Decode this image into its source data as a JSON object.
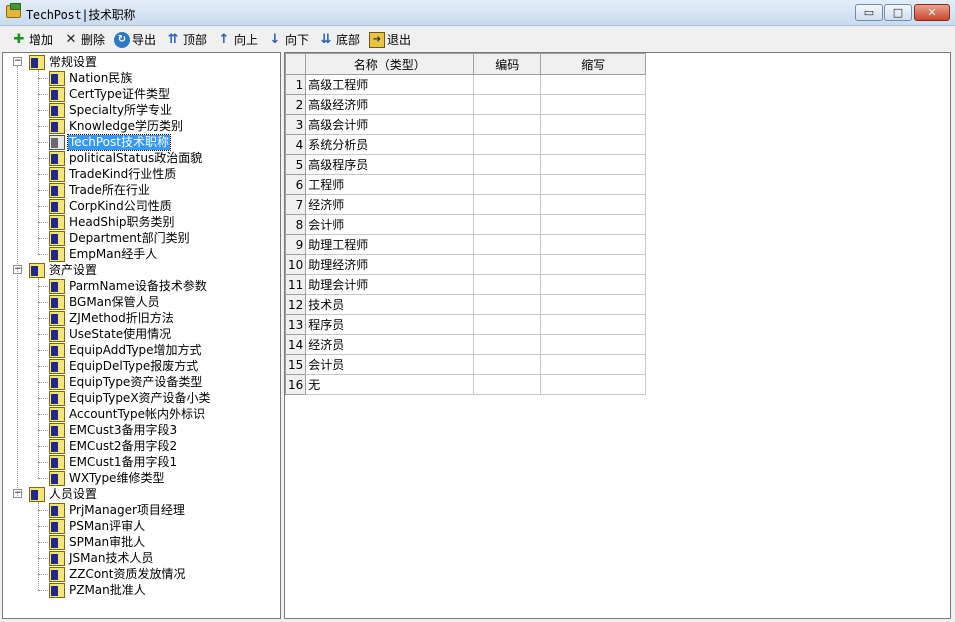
{
  "window": {
    "title": "TechPost|技术职称",
    "min_label": "▭",
    "max_label": "□",
    "close_label": "✕"
  },
  "toolbar": [
    {
      "id": "add",
      "label": "增加",
      "icon": "add-icon"
    },
    {
      "id": "delete",
      "label": "删除",
      "icon": "delete-icon"
    },
    {
      "id": "export",
      "label": "导出",
      "icon": "export-icon"
    },
    {
      "id": "top",
      "label": "顶部",
      "icon": "move-top-icon"
    },
    {
      "id": "up",
      "label": "向上",
      "icon": "move-up-icon"
    },
    {
      "id": "down",
      "label": "向下",
      "icon": "move-down-icon"
    },
    {
      "id": "bottom",
      "label": "底部",
      "icon": "move-bottom-icon"
    },
    {
      "id": "exit",
      "label": "退出",
      "icon": "exit-icon"
    }
  ],
  "tree": [
    {
      "label": "常规设置",
      "expanded": true,
      "children": [
        "Nation民族",
        "CertType证件类型",
        "Specialty所学专业",
        "Knowledge学历类别",
        "TechPost技术职称",
        "politicalStatus政治面貌",
        "TradeKind行业性质",
        "Trade所在行业",
        "CorpKind公司性质",
        "HeadShip职务类别",
        "Department部门类别",
        "EmpMan经手人"
      ]
    },
    {
      "label": "资产设置",
      "expanded": true,
      "children": [
        "ParmName设备技术参数",
        "BGMan保管人员",
        "ZJMethod折旧方法",
        "UseState使用情况",
        "EquipAddType增加方式",
        "EquipDelType报废方式",
        "EquipType资产设备类型",
        "EquipTypeX资产设备小类",
        "AccountType帐内外标识",
        "EMCust3备用字段3",
        "EMCust2备用字段2",
        "EMCust1备用字段1",
        "WXType维修类型"
      ]
    },
    {
      "label": "人员设置",
      "expanded": true,
      "children": [
        "PrjManager项目经理",
        "PSMan评审人",
        "SPMan审批人",
        "JSMan技术人员",
        "ZZCont资质发放情况",
        "PZMan批准人"
      ]
    }
  ],
  "tree_selected": "TechPost技术职称",
  "grid": {
    "columns": [
      "名称（类型）",
      "编码",
      "缩写"
    ],
    "rows": [
      {
        "n": "1",
        "name": "高级工程师",
        "code": "",
        "abbr": ""
      },
      {
        "n": "2",
        "name": "高级经济师",
        "code": "",
        "abbr": ""
      },
      {
        "n": "3",
        "name": "高级会计师",
        "code": "",
        "abbr": ""
      },
      {
        "n": "4",
        "name": "系统分析员",
        "code": "",
        "abbr": ""
      },
      {
        "n": "5",
        "name": "高级程序员",
        "code": "",
        "abbr": ""
      },
      {
        "n": "6",
        "name": "工程师",
        "code": "",
        "abbr": ""
      },
      {
        "n": "7",
        "name": "经济师",
        "code": "",
        "abbr": ""
      },
      {
        "n": "8",
        "name": "会计师",
        "code": "",
        "abbr": ""
      },
      {
        "n": "9",
        "name": "助理工程师",
        "code": "",
        "abbr": ""
      },
      {
        "n": "10",
        "name": "助理经济师",
        "code": "",
        "abbr": ""
      },
      {
        "n": "11",
        "name": "助理会计师",
        "code": "",
        "abbr": ""
      },
      {
        "n": "12",
        "name": "技术员",
        "code": "",
        "abbr": ""
      },
      {
        "n": "13",
        "name": "程序员",
        "code": "",
        "abbr": ""
      },
      {
        "n": "14",
        "name": "经济员",
        "code": "",
        "abbr": ""
      },
      {
        "n": "15",
        "name": "会计员",
        "code": "",
        "abbr": ""
      },
      {
        "n": "16",
        "name": "无",
        "code": "",
        "abbr": ""
      }
    ]
  }
}
